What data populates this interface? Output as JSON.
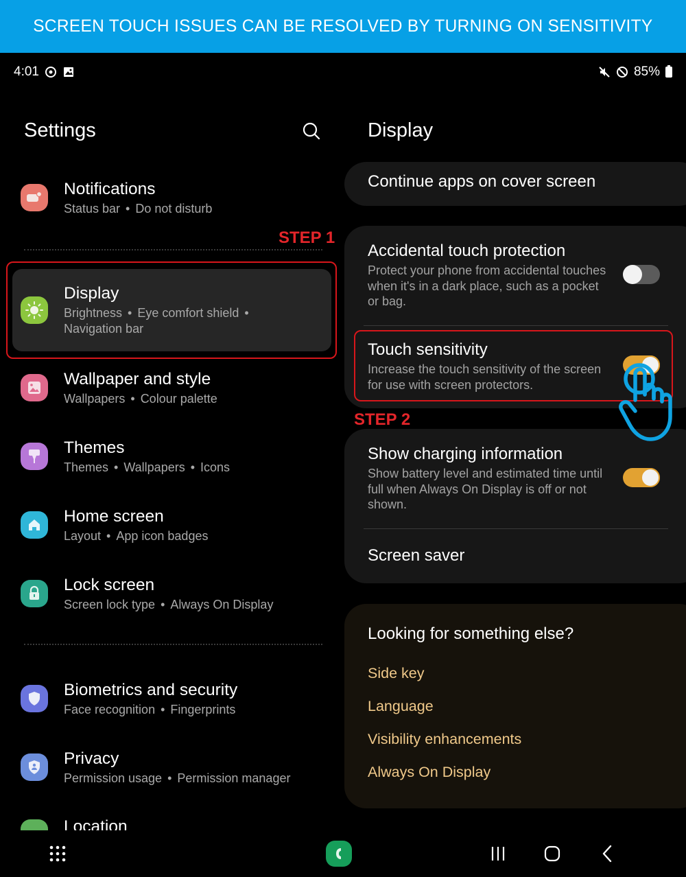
{
  "banner": {
    "text": "SCREEN TOUCH ISSUES CAN BE RESOLVED BY TURNING ON SENSITIVITY",
    "color": "#07a0e6"
  },
  "status_bar": {
    "time": "4:01",
    "left_icons": [
      "sync-icon",
      "gallery-icon"
    ],
    "right_icons": [
      "mute-icon",
      "do-not-disturb-icon"
    ],
    "battery": "85%"
  },
  "settings_pane": {
    "title": "Settings",
    "search_icon": "search-icon",
    "items": [
      {
        "id": "notifications",
        "title": "Notifications",
        "sub": [
          "Status bar",
          "Do not disturb"
        ],
        "icon": "notifications-icon",
        "color": "#e8786d"
      },
      {
        "id": "display",
        "title": "Display",
        "sub": [
          "Brightness",
          "Eye comfort shield",
          "Navigation bar"
        ],
        "icon": "brightness-icon",
        "color": "#8cc63e",
        "selected": true
      },
      {
        "id": "wallpaper",
        "title": "Wallpaper and style",
        "sub": [
          "Wallpapers",
          "Colour palette"
        ],
        "icon": "wallpaper-icon",
        "color": "#e0698c"
      },
      {
        "id": "themes",
        "title": "Themes",
        "sub": [
          "Themes",
          "Wallpapers",
          "Icons"
        ],
        "icon": "paintbrush-icon",
        "color": "#b777d8"
      },
      {
        "id": "home",
        "title": "Home screen",
        "sub": [
          "Layout",
          "App icon badges"
        ],
        "icon": "home-icon",
        "color": "#2fb6d8"
      },
      {
        "id": "lock",
        "title": "Lock screen",
        "sub": [
          "Screen lock type",
          "Always On Display"
        ],
        "icon": "lock-icon",
        "color": "#2aa68c"
      },
      {
        "id": "biometrics",
        "title": "Biometrics and security",
        "sub": [
          "Face recognition",
          "Fingerprints"
        ],
        "icon": "shield-icon",
        "color": "#6a74de"
      },
      {
        "id": "privacy",
        "title": "Privacy",
        "sub": [
          "Permission usage",
          "Permission manager"
        ],
        "icon": "privacy-shield-icon",
        "color": "#6c8edc"
      },
      {
        "id": "location",
        "title": "Location",
        "sub": [],
        "icon": "location-icon",
        "color": "#5db05a"
      }
    ]
  },
  "annotations": {
    "step1": "STEP 1",
    "step2": "STEP 2",
    "highlight_color": "#d8161b"
  },
  "display_pane": {
    "title": "Display",
    "continue_apps": "Continue apps on cover screen",
    "accidental_touch": {
      "title": "Accidental touch protection",
      "desc": "Protect your phone from accidental touches when it's in a dark place, such as a pocket or bag.",
      "enabled": false
    },
    "touch_sensitivity": {
      "title": "Touch sensitivity",
      "desc": "Increase the touch sensitivity of the screen for use with screen protectors.",
      "enabled": true
    },
    "charging_info": {
      "title": "Show charging information",
      "desc": "Show battery level and estimated time until full when Always On Display is off or not shown.",
      "enabled": true
    },
    "screen_saver": "Screen saver",
    "toggle_on_color": "#e2a232"
  },
  "suggestions": {
    "title": "Looking for something else?",
    "links": [
      "Side key",
      "Language",
      "Visibility enhancements",
      "Always On Display"
    ]
  },
  "nav_bar": {
    "apps_icon": "app-drawer-icon",
    "pinned_app": "phone-app-icon",
    "recents": "recents-icon",
    "home": "home-button-icon",
    "back": "back-icon"
  }
}
